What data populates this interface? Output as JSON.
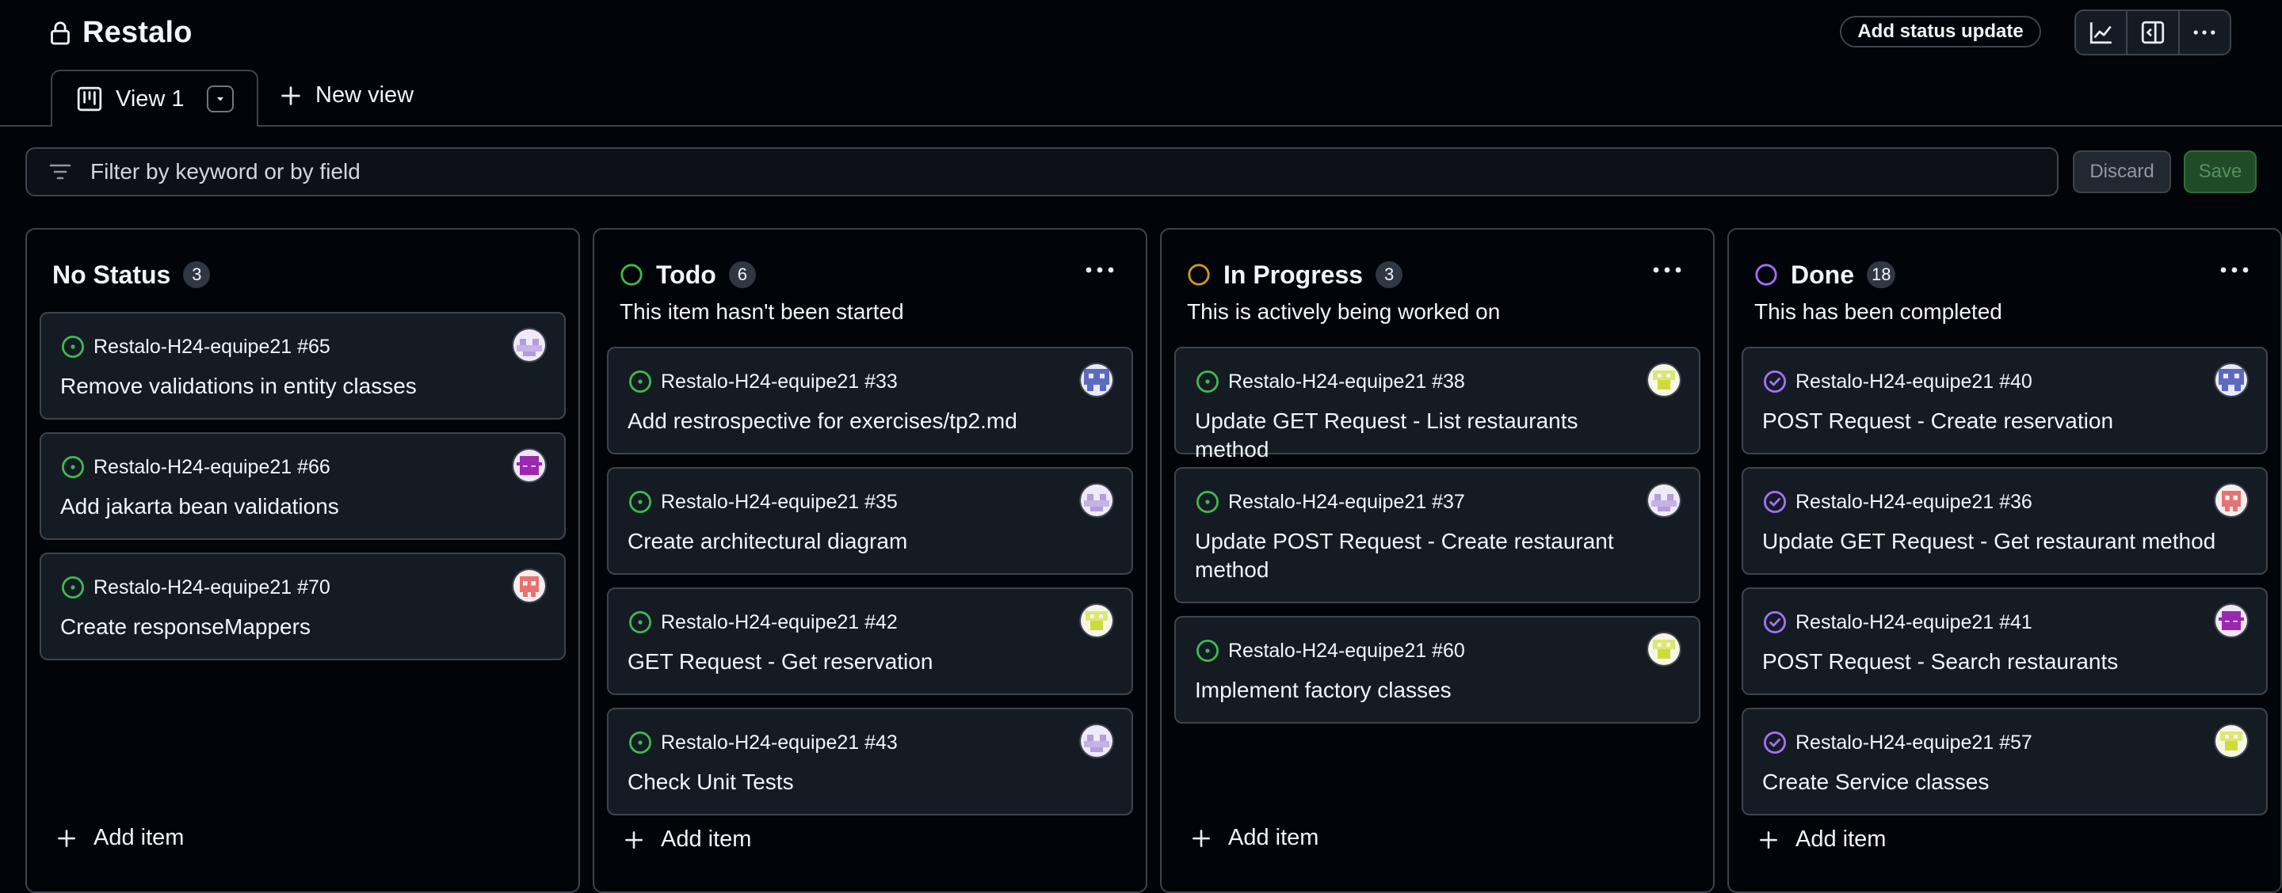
{
  "header": {
    "title": "Restalo",
    "status_button": "Add status update",
    "icons": [
      "insights-icon",
      "side-panel-icon",
      "more-options-icon"
    ]
  },
  "tabs": {
    "active_label": "View 1",
    "new_view_label": "New view"
  },
  "filter": {
    "placeholder": "Filter by keyword or by field",
    "discard_label": "Discard",
    "save_label": "Save"
  },
  "colors": {
    "todo": "#3fb950",
    "in_progress": "#d29922",
    "done": "#a371f7",
    "open_issue": "#3fb950",
    "closed_issue": "#a371f7"
  },
  "columns": [
    {
      "name": "No Status",
      "count": "3",
      "description": "",
      "add_label": "Add item",
      "cards": [
        {
          "ref": "Restalo-H24-equipe21 #65",
          "title": "Remove validations in entity classes",
          "avatar": "lavender"
        },
        {
          "ref": "Restalo-H24-equipe21 #66",
          "title": "Add jakarta bean validations",
          "avatar": "purple"
        },
        {
          "ref": "Restalo-H24-equipe21 #70",
          "title": "Create responseMappers",
          "avatar": "pink"
        }
      ]
    },
    {
      "name": "Todo",
      "count": "6",
      "description": "This item hasn't been started",
      "add_label": "Add item",
      "cards": [
        {
          "ref": "Restalo-H24-equipe21 #33",
          "title": "Add restrospective for exercises/tp2.md",
          "avatar": "indigo"
        },
        {
          "ref": "Restalo-H24-equipe21 #35",
          "title": "Create architectural diagram",
          "avatar": "lavender"
        },
        {
          "ref": "Restalo-H24-equipe21 #42",
          "title": "GET Request - Get reservation",
          "avatar": "yellow"
        },
        {
          "ref": "Restalo-H24-equipe21 #43",
          "title": "Check Unit Tests",
          "avatar": "lavender"
        }
      ]
    },
    {
      "name": "In Progress",
      "count": "3",
      "description": "This is actively being worked on",
      "add_label": "Add item",
      "cards": [
        {
          "ref": "Restalo-H24-equipe21 #38",
          "title": "Update GET Request - List restaurants method",
          "avatar": "yellow"
        },
        {
          "ref": "Restalo-H24-equipe21 #37",
          "title": "Update POST Request - Create restaurant method",
          "avatar": "lavender"
        },
        {
          "ref": "Restalo-H24-equipe21 #60",
          "title": "Implement factory classes",
          "avatar": "yellow"
        }
      ]
    },
    {
      "name": "Done",
      "count": "18",
      "description": "This has been completed",
      "add_label": "Add item",
      "cards": [
        {
          "ref": "Restalo-H24-equipe21 #40",
          "title": "POST Request - Create reservation",
          "avatar": "indigo"
        },
        {
          "ref": "Restalo-H24-equipe21 #36",
          "title": "Update GET Request - Get restaurant method",
          "avatar": "pink"
        },
        {
          "ref": "Restalo-H24-equipe21 #41",
          "title": "POST Request - Search restaurants",
          "avatar": "purple"
        },
        {
          "ref": "Restalo-H24-equipe21 #57",
          "title": "Create Service classes",
          "avatar": "yellow"
        }
      ]
    }
  ]
}
